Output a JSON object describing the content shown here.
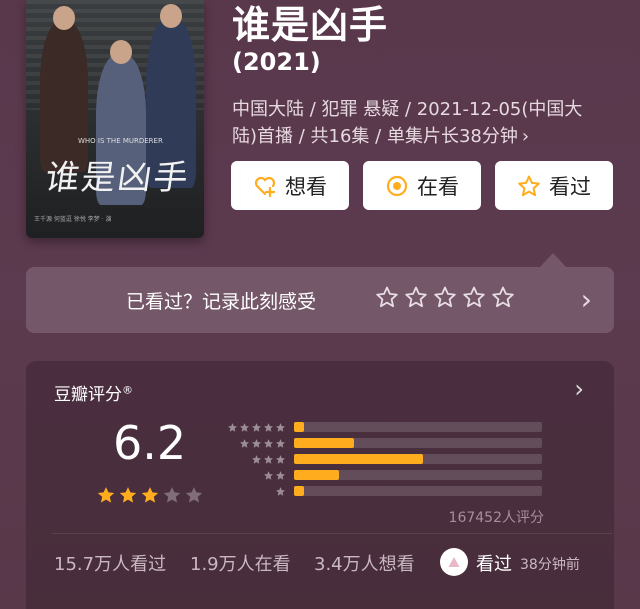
{
  "poster": {
    "title_art": "谁是凶手",
    "subtitle_art": "WHO IS THE MURDERER",
    "credits": "王千源 何蓝逗 徐悦 李梦 · 演"
  },
  "title": "谁是凶手",
  "year": "(2021)",
  "meta": "中国大陆 / 犯罪 悬疑 / 2021-12-05(中国大陆)首播 / 共16集 / 单集片长38分钟",
  "meta_chevron": "›",
  "actions": {
    "want_label": "想看",
    "watching_label": "在看",
    "watched_label": "看过"
  },
  "record": {
    "prompt": "已看过？记录此刻感受",
    "stars": 5,
    "chevron": "›"
  },
  "rating": {
    "title": "豆瓣评分",
    "title_mark": "®",
    "chevron": "›",
    "score": "6.2",
    "score_stars": 3,
    "rating_count": "167452人评分"
  },
  "chart_data": {
    "type": "bar",
    "categories": [
      "5星",
      "4星",
      "3星",
      "2星",
      "1星"
    ],
    "values": [
      2,
      12,
      26,
      9,
      2
    ],
    "orientation": "horizontal",
    "xlim": [
      0,
      50
    ]
  },
  "stats": {
    "seen": "15.7万人看过",
    "watching": "1.9万人在看",
    "wish": "3.4万人想看",
    "my_status": "看过",
    "time_ago": "38分钟前"
  },
  "colors": {
    "background": "#5b3a4f",
    "accent": "#ffad1f",
    "button_bg": "#ffffff"
  }
}
